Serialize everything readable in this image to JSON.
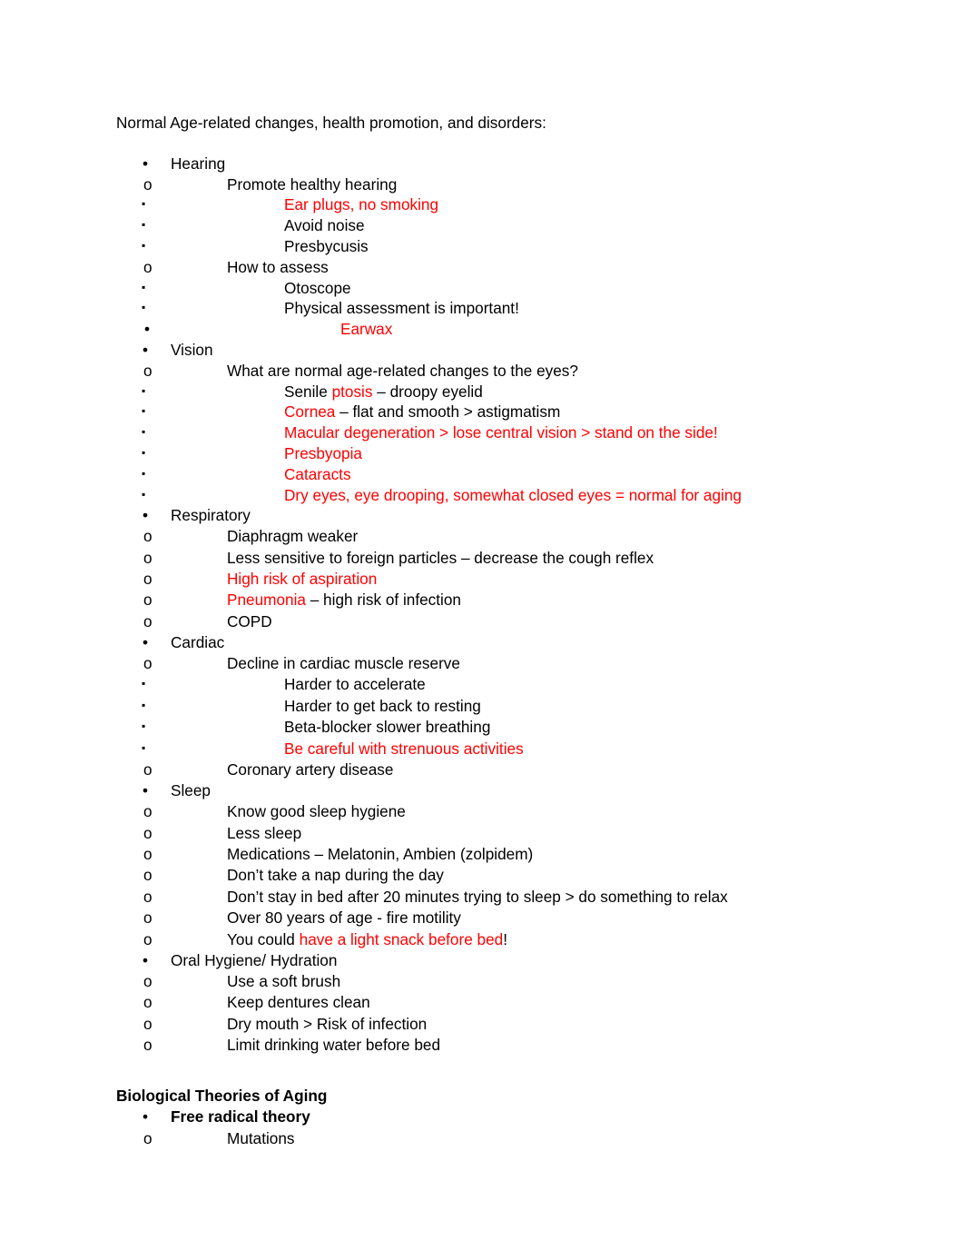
{
  "document": {
    "title": "Normal Age-related changes, health promotion, and disorders:",
    "colors": {
      "text": "#000000",
      "highlight": "#FF0000",
      "background": "#FFFFFF"
    },
    "markers": {
      "level1": "•",
      "level2": "o",
      "level3": "▪",
      "level4": "•"
    },
    "sections": [
      {
        "heading": "Hearing",
        "subsections": [
          {
            "label": "Promote healthy hearing",
            "items": [
              {
                "parts": [
                  {
                    "text": "Ear plugs, no smoking",
                    "color": "red"
                  }
                ]
              },
              {
                "parts": [
                  {
                    "text": "Avoid noise",
                    "color": "black"
                  }
                ]
              },
              {
                "parts": [
                  {
                    "text": "Presbycusis",
                    "color": "black"
                  }
                ]
              }
            ]
          },
          {
            "label": "How to assess",
            "items": [
              {
                "parts": [
                  {
                    "text": "Otoscope",
                    "color": "black"
                  }
                ]
              },
              {
                "parts": [
                  {
                    "text": "Physical assessment is important!",
                    "color": "black"
                  }
                ],
                "children": [
                  {
                    "parts": [
                      {
                        "text": "Earwax",
                        "color": "red"
                      }
                    ]
                  }
                ]
              }
            ]
          }
        ]
      },
      {
        "heading": "Vision",
        "subsections": [
          {
            "label": "What are normal age-related changes to the eyes?",
            "items": [
              {
                "parts": [
                  {
                    "text": "Senile ",
                    "color": "black"
                  },
                  {
                    "text": "ptosis",
                    "color": "red"
                  },
                  {
                    "text": " – droopy eyelid",
                    "color": "black"
                  }
                ]
              },
              {
                "parts": [
                  {
                    "text": "Cornea",
                    "color": "red"
                  },
                  {
                    "text": " – flat and smooth > astigmatism",
                    "color": "black"
                  }
                ]
              },
              {
                "parts": [
                  {
                    "text": "Macular degeneration > lose central vision > stand on the side!",
                    "color": "red"
                  }
                ]
              },
              {
                "parts": [
                  {
                    "text": "Presbyopia",
                    "color": "red"
                  }
                ]
              },
              {
                "parts": [
                  {
                    "text": "Cataracts",
                    "color": "red"
                  }
                ]
              },
              {
                "parts": [
                  {
                    "text": "Dry eyes, eye drooping, somewhat closed eyes = normal for aging",
                    "color": "red"
                  }
                ]
              }
            ]
          }
        ]
      },
      {
        "heading": "Respiratory",
        "subsections": [
          {
            "label": "Diaphragm weaker",
            "label_color": "black",
            "items": []
          },
          {
            "label": "Less sensitive to foreign particles – decrease the cough reflex",
            "label_color": "black",
            "items": []
          },
          {
            "label": "High risk of aspiration",
            "label_color": "red",
            "items": []
          },
          {
            "label_parts": [
              {
                "text": "Pneumonia",
                "color": "red"
              },
              {
                "text": " – high risk of infection",
                "color": "black"
              }
            ],
            "items": []
          },
          {
            "label": "COPD",
            "label_color": "black",
            "items": []
          }
        ]
      },
      {
        "heading": "Cardiac",
        "subsections": [
          {
            "label": "Decline in cardiac muscle reserve",
            "items": [
              {
                "parts": [
                  {
                    "text": "Harder to accelerate",
                    "color": "black"
                  }
                ]
              },
              {
                "parts": [
                  {
                    "text": "Harder to get back to resting",
                    "color": "black"
                  }
                ]
              },
              {
                "parts": [
                  {
                    "text": "Beta-blocker slower breathing",
                    "color": "black"
                  }
                ]
              },
              {
                "parts": [
                  {
                    "text": "Be careful with strenuous activities",
                    "color": "red"
                  }
                ]
              }
            ]
          },
          {
            "label": "Coronary artery disease",
            "label_color": "black",
            "items": []
          }
        ]
      },
      {
        "heading": "Sleep",
        "subsections": [
          {
            "label": "Know good sleep hygiene",
            "label_color": "black",
            "items": []
          },
          {
            "label": "Less sleep",
            "label_color": "black",
            "items": []
          },
          {
            "label": "Medications – Melatonin, Ambien (zolpidem)",
            "label_color": "black",
            "items": []
          },
          {
            "label": "Don’t take a nap during the day",
            "label_color": "black",
            "items": []
          },
          {
            "label": "Don’t stay in bed after 20 minutes trying to sleep > do something to relax",
            "label_color": "black",
            "items": []
          },
          {
            "label": "Over 80 years of age - fire motility",
            "label_color": "black",
            "items": []
          },
          {
            "label_parts": [
              {
                "text": "You could ",
                "color": "black"
              },
              {
                "text": "have a light snack before bed",
                "color": "red"
              },
              {
                "text": "!",
                "color": "black"
              }
            ],
            "items": []
          }
        ]
      },
      {
        "heading": "Oral Hygiene/ Hydration",
        "subsections": [
          {
            "label": "Use a soft brush",
            "label_color": "black",
            "items": []
          },
          {
            "label": "Keep dentures clean",
            "label_color": "black",
            "items": []
          },
          {
            "label": "Dry mouth > Risk of infection",
            "label_color": "black",
            "items": []
          },
          {
            "label": "Limit drinking water before bed",
            "label_color": "black",
            "items": []
          }
        ]
      }
    ],
    "second_heading": {
      "title": "Biological Theories of Aging",
      "bullet": "Free radical theory",
      "sub_bullet": "Mutations"
    }
  }
}
